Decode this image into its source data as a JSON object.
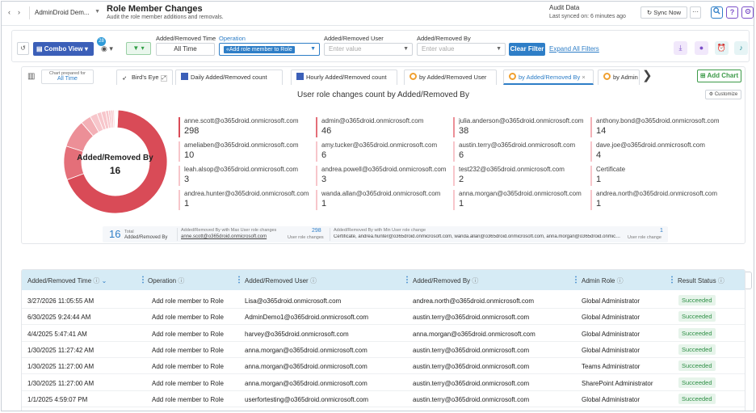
{
  "topbar": {
    "back": "‹",
    "forward": "›",
    "tenant": "AdminDroid Dem...",
    "title": "Role Member Changes",
    "subtitle": "Audit the role member additions and removals.",
    "audit_label": "Audit Data",
    "last_synced": "Last synced on: 6 minutes ago",
    "sync_label": "Sync Now",
    "more": "···",
    "search_icon": "search-icon",
    "help": "?",
    "accent": "#2e7ec7"
  },
  "filters": {
    "combo_view": "Combo View",
    "badge": "28",
    "time_label": "Added/Removed Time",
    "time_value": "All Time",
    "operation_label": "Operation",
    "operation_value": "«Add role member to Role",
    "user_label": "Added/Removed User",
    "user_placeholder": "Enter value",
    "by_label": "Added/Removed By",
    "by_placeholder": "Enter value",
    "clear": "Clear Filter",
    "expand": "Expand All Filters"
  },
  "chart_tabs": {
    "prepared_label": "Chart prepared for",
    "prepared_value": "All Time",
    "tabs": [
      "Bird's Eye",
      "Daily Added/Removed count",
      "Hourly Added/Removed count",
      "by Added/Removed User",
      "by Added/Removed By",
      "by Admin"
    ],
    "add_chart": "Add Chart",
    "customize": "Customize"
  },
  "chart_data": {
    "type": "pie",
    "title": "User role changes count by Added/Removed By",
    "center_label": "Added/Removed By",
    "center_value": "16",
    "slices": [
      {
        "name": "anne.scott@o365droid.onmicrosoft.com",
        "value": 298
      },
      {
        "name": "admin@o365droid.onmicrosoft.com",
        "value": 46
      },
      {
        "name": "julia.anderson@o365droid.onmicrosoft.com",
        "value": 38
      },
      {
        "name": "anthony.bond@o365droid.onmicrosoft.com",
        "value": 14
      },
      {
        "name": "ameliaben@o365droid.onmicrosoft.com",
        "value": 10
      },
      {
        "name": "amy.tucker@o365droid.onmicrosoft.com",
        "value": 6
      },
      {
        "name": "austin.terry@o365droid.onmicrosoft.com",
        "value": 6
      },
      {
        "name": "dave.joe@o365droid.onmicrosoft.com",
        "value": 4
      },
      {
        "name": "leah.alsop@o365droid.onmicrosoft.com",
        "value": 3
      },
      {
        "name": "andrea.powell@o365droid.onmicrosoft.com",
        "value": 3
      },
      {
        "name": "test232@o365droid.onmicrosoft.com",
        "value": 2
      },
      {
        "name": "Certificate",
        "value": 1
      },
      {
        "name": "andrea.hunter@o365droid.onmicrosoft.com",
        "value": 1
      },
      {
        "name": "wanda.allan@o365droid.onmicrosoft.com",
        "value": 1
      },
      {
        "name": "anna.morgan@o365droid.onmicrosoft.com",
        "value": 1
      },
      {
        "name": "andrea.north@o365droid.onmicrosoft.com",
        "value": 1
      }
    ],
    "colors": [
      "#d94b57",
      "#e46f79",
      "#ec8f97",
      "#f3b0b6",
      "#f7c6cb"
    ]
  },
  "summary": {
    "total": "16",
    "total_label1": "Total",
    "total_label2": "Added/Removed By",
    "max_label": "Added/Removed By with Max User role changes",
    "max_user": "anne.scott@o365droid.onmicrosoft.com",
    "max_value": "298",
    "max_unit": "User role changes",
    "min_label": "Added/Removed By with Min User role change",
    "min_users": "Certificate, andrea.hunter@o365droid.onmicrosoft.com, wanda.allan@o365droid.onmicrosoft.com, anna.morgan@o365droid.onmicrosoft.com, andrea.north@o365droid.onmicrosoft.com",
    "min_value": "1",
    "min_unit": "User role change"
  },
  "table": {
    "columns": [
      "Added/Removed Time",
      "Operation",
      "Added/Removed User",
      "Added/Removed By",
      "Admin Role",
      "Result Status"
    ],
    "rows": [
      [
        "3/27/2026 11:05:55 AM",
        "Add role member to Role",
        "Lisa@o365droid.onmicrosoft.com",
        "andrea.north@o365droid.onmicrosoft.com",
        "Global Administrator",
        "Succeeded"
      ],
      [
        "6/30/2025 9:24:44 AM",
        "Add role member to Role",
        "AdminDemo1@o365droid.onmicrosoft.com",
        "austin.terry@o365droid.onmicrosoft.com",
        "Global Administrator",
        "Succeeded"
      ],
      [
        "4/4/2025 5:47:41 AM",
        "Add role member to Role",
        "harvey@o365droid.onmicrosoft.com",
        "anna.morgan@o365droid.onmicrosoft.com",
        "Global Administrator",
        "Succeeded"
      ],
      [
        "1/30/2025 11:27:42 AM",
        "Add role member to Role",
        "anna.morgan@o365droid.onmicrosoft.com",
        "austin.terry@o365droid.onmicrosoft.com",
        "Global Administrator",
        "Succeeded"
      ],
      [
        "1/30/2025 11:27:00 AM",
        "Add role member to Role",
        "anna.morgan@o365droid.onmicrosoft.com",
        "austin.terry@o365droid.onmicrosoft.com",
        "Teams Administrator",
        "Succeeded"
      ],
      [
        "1/30/2025 11:27:00 AM",
        "Add role member to Role",
        "anna.morgan@o365droid.onmicrosoft.com",
        "austin.terry@o365droid.onmicrosoft.com",
        "SharePoint Administrator",
        "Succeeded"
      ],
      [
        "1/1/2025 4:59:07 PM",
        "Add role member to Role",
        "userfortesting@o365droid.onmicrosoft.com",
        "austin.terry@o365droid.onmicrosoft.com",
        "Global Administrator",
        "Succeeded"
      ]
    ]
  }
}
